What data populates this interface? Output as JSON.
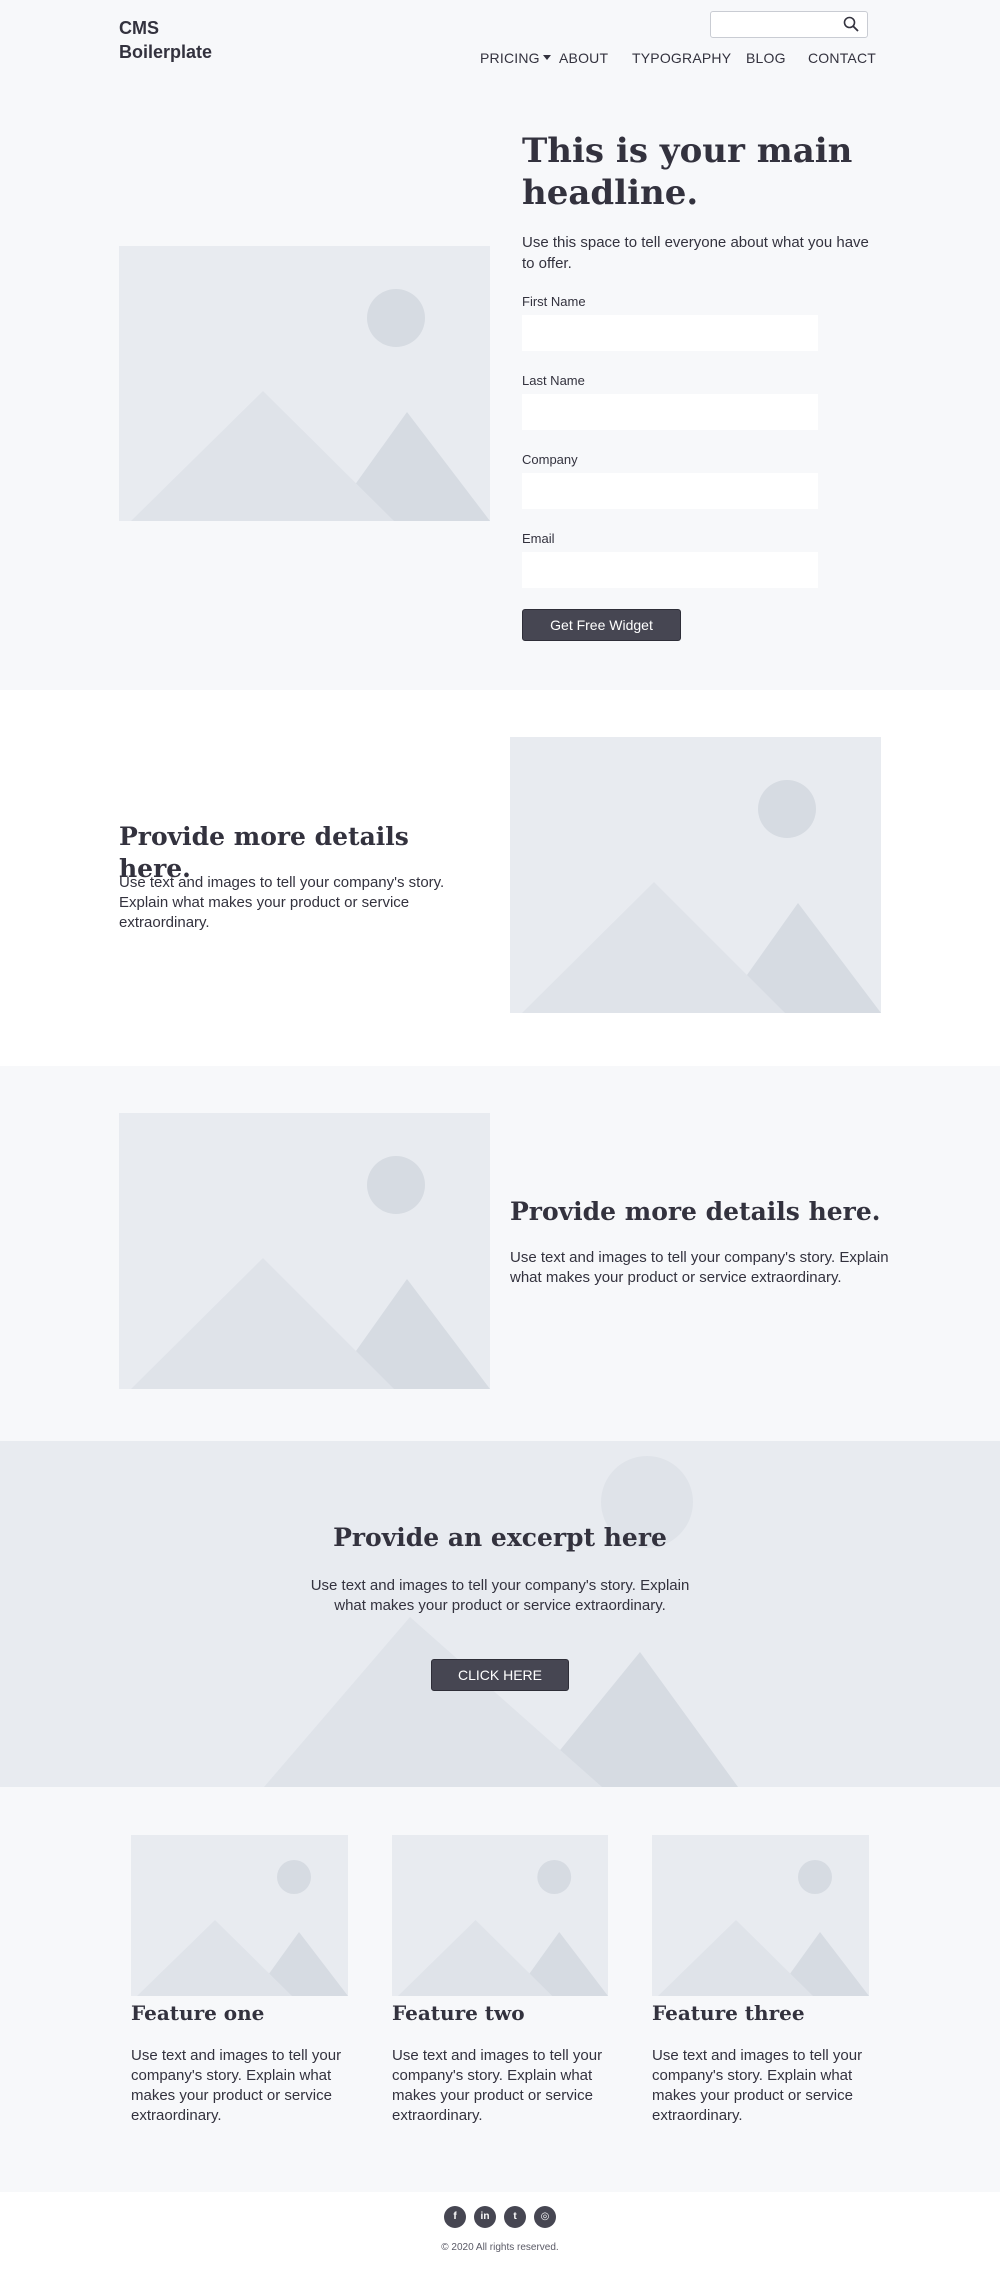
{
  "header": {
    "logo_line1": "CMS",
    "logo_line2": "Boilerplate",
    "search": {
      "placeholder": "",
      "icon": "search-icon"
    },
    "nav": [
      {
        "label": "PRICING",
        "has_dropdown": true
      },
      {
        "label": "ABOUT"
      },
      {
        "label": "TYPOGRAPHY"
      },
      {
        "label": "BLOG"
      },
      {
        "label": "CONTACT"
      }
    ]
  },
  "hero": {
    "headline": "This is your main headline.",
    "lead": "Use this space to tell everyone about what you have to offer.",
    "form": {
      "fields": [
        {
          "label": "First Name",
          "value": ""
        },
        {
          "label": "Last Name",
          "value": ""
        },
        {
          "label": "Company",
          "value": ""
        },
        {
          "label": "Email",
          "value": ""
        }
      ],
      "submit_label": "Get Free Widget"
    }
  },
  "section_one": {
    "title": "Provide more details here.",
    "body": "Use text and images to tell your company's story. Explain what makes your product or service extraordinary."
  },
  "section_two": {
    "title": "Provide more details here.",
    "body": "Use text and images to tell your company's story. Explain what makes your product or service extraordinary."
  },
  "excerpt": {
    "title": "Provide an excerpt here",
    "body": "Use text and images to tell your company's story. Explain what makes your product or service extraordinary.",
    "button_label": "CLICK HERE"
  },
  "features": [
    {
      "title": "Feature one",
      "body": "Use text and images to tell your company's story. Explain what makes your product or service extraordinary."
    },
    {
      "title": "Feature two",
      "body": "Use text and images to tell your company's story. Explain what makes your product or service extraordinary."
    },
    {
      "title": "Feature three",
      "body": "Use text and images to tell your company's story. Explain what makes your product or service extraordinary."
    }
  ],
  "footer": {
    "social": [
      {
        "icon": "facebook-icon",
        "glyph": "f"
      },
      {
        "icon": "linkedin-icon",
        "glyph": "in"
      },
      {
        "icon": "twitter-icon",
        "glyph": "t"
      },
      {
        "icon": "instagram-icon",
        "glyph": "◎"
      }
    ],
    "copyright": "© 2020 All rights reserved."
  },
  "colors": {
    "text": "#33323e",
    "button": "#464652",
    "placeholder_bg": "#e8ebf0",
    "placeholder_shape": "#dfe3e9",
    "placeholder_shape_dark": "#d6dbe2"
  }
}
